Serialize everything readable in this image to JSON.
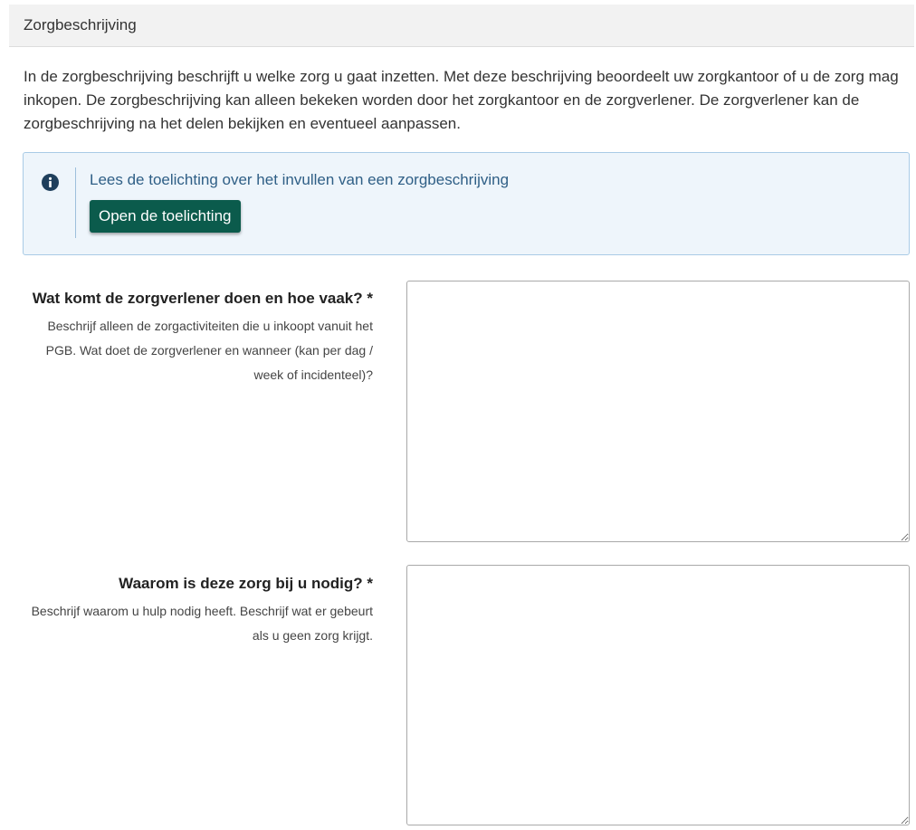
{
  "panel": {
    "title": "Zorgbeschrijving"
  },
  "intro": {
    "text": "In de zorgbeschrijving beschrijft u welke zorg u gaat inzetten. Met deze beschrijving beoordeelt uw zorgkantoor of u de zorg mag inkopen. De zorgbeschrijving kan alleen bekeken worden door het zorgkantoor en de zorgverlener. De zorgverlener kan de zorgbeschrijving na het delen bekijken en eventueel aanpassen."
  },
  "info": {
    "icon": "info-circle-icon",
    "text": "Lees de toelichting over het invullen van een zorgbeschrijving",
    "button_label": "Open de toelichting"
  },
  "fields": [
    {
      "title": "Wat komt de zorgverlener doen en hoe vaak? *",
      "help": "Beschrijf alleen de zorgactiviteiten die u inkoopt vanuit het PGB. Wat doet de zorgverlener en wanneer (kan per dag / week of incidenteel)?",
      "value": ""
    },
    {
      "title": "Waarom is deze zorg bij u nodig? *",
      "help": "Beschrijf waarom u hulp nodig heeft. Beschrijf wat er gebeurt als u geen zorg krijgt.",
      "value": ""
    }
  ],
  "colors": {
    "button": "#0b5b4c",
    "info_background": "#eef5fb",
    "info_border": "#a9cbe6",
    "info_text": "#2f5f86",
    "icon": "#1f3f5c"
  }
}
